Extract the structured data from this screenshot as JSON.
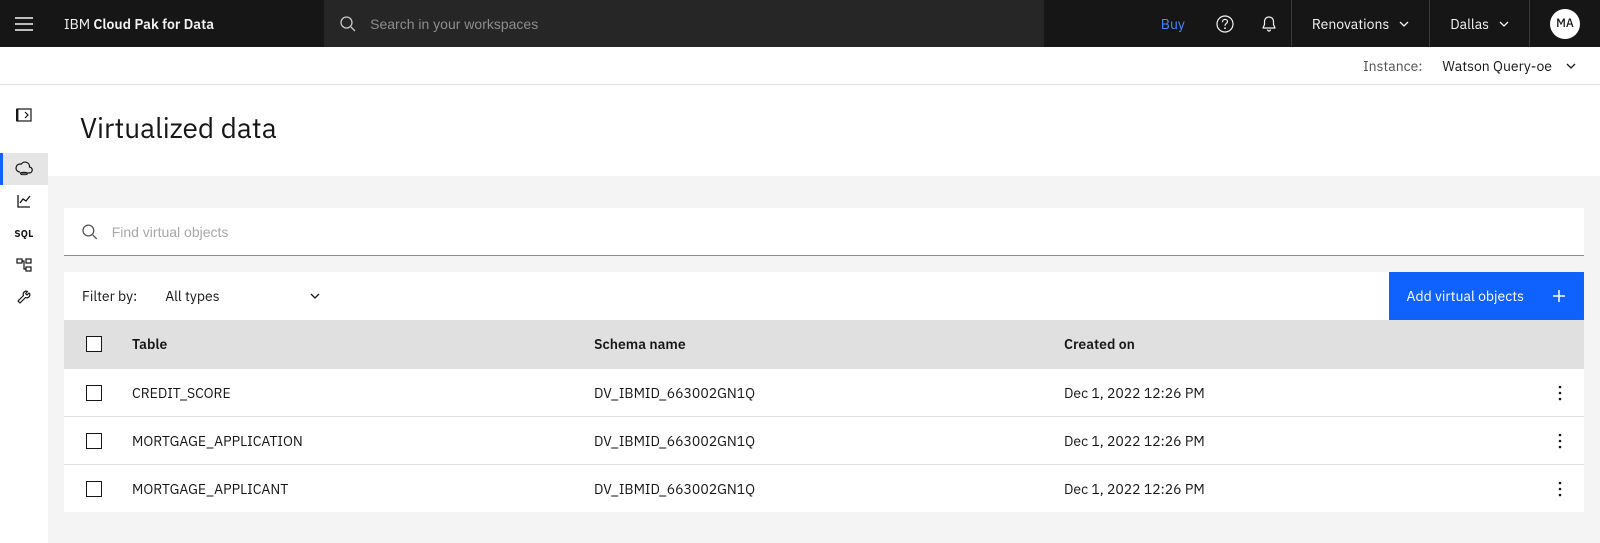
{
  "header": {
    "brand_prefix": "IBM ",
    "brand_bold": "Cloud Pak for Data",
    "search_placeholder": "Search in your workspaces",
    "buy_label": "Buy",
    "account_label": "Renovations",
    "region_label": "Dallas",
    "avatar_initials": "MA"
  },
  "instance": {
    "label": "Instance:",
    "value": "Watson Query-oe"
  },
  "page": {
    "title": "Virtualized data",
    "search_placeholder": "Find virtual objects",
    "filter_label": "Filter by:",
    "type_value": "All types",
    "add_button": "Add virtual objects"
  },
  "table": {
    "columns": {
      "table": "Table",
      "schema": "Schema name",
      "created": "Created on"
    },
    "rows": [
      {
        "table": "CREDIT_SCORE",
        "schema": "DV_IBMID_663002GN1Q",
        "created": "Dec 1, 2022 12:26 PM"
      },
      {
        "table": "MORTGAGE_APPLICATION",
        "schema": "DV_IBMID_663002GN1Q",
        "created": "Dec 1, 2022 12:26 PM"
      },
      {
        "table": "MORTGAGE_APPLICANT",
        "schema": "DV_IBMID_663002GN1Q",
        "created": "Dec 1, 2022 12:26 PM"
      }
    ]
  }
}
